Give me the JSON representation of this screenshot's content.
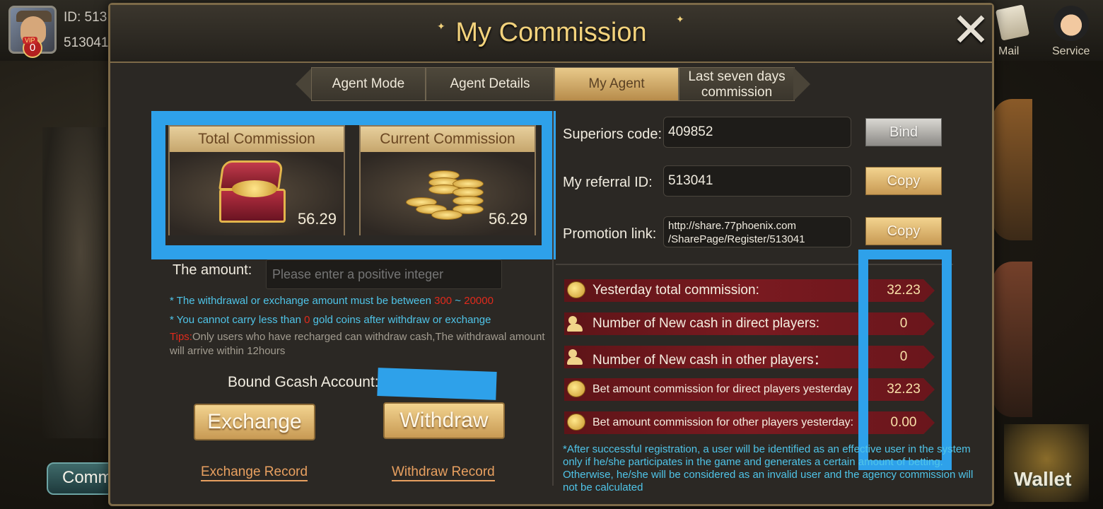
{
  "background": {
    "id_text": "ID: 513",
    "id_number": "513041",
    "vip_level": "0",
    "vip_tag": "VIP",
    "mail_label": "Mail",
    "service_label": "Service",
    "comm_label": "Comm",
    "wallet_label": "Wallet"
  },
  "modal": {
    "title": "My Commission",
    "close_icon": "close-icon"
  },
  "tabs": [
    {
      "label": "Agent Mode",
      "active": false
    },
    {
      "label": "Agent Details",
      "active": false
    },
    {
      "label": "My Agent",
      "active": true
    },
    {
      "label": "Last seven days commission",
      "active": false
    }
  ],
  "cards": {
    "total_label": "Total Commission",
    "total_value": "56.29",
    "current_label": "Current Commission",
    "current_value": "56.29"
  },
  "withdraw": {
    "amount_label": "The amount:",
    "amount_placeholder": "Please enter a positive integer",
    "note1_prefix": "* The withdrawal or exchange amount must be between ",
    "note1_min": "300",
    "note1_sep": " ~ ",
    "note1_max": "20000",
    "note2_prefix": "* You cannot carry less than ",
    "note2_value": "0",
    "note2_suffix": " gold coins after withdraw or exchange",
    "tips_label": "Tips:",
    "tips_text": "Only users who have recharged can withdraw cash,The withdrawal amount will arrive within 12hours",
    "gcash_label": "Bound Gcash Account:",
    "exchange_button": "Exchange",
    "withdraw_button": "Withdraw",
    "exchange_record": "Exchange Record",
    "withdraw_record": "Withdraw Record"
  },
  "agent_form": {
    "superiors_label": "Superiors code:",
    "superiors_value": "409852",
    "bind_button": "Bind",
    "referral_label": "My referral ID:",
    "referral_value": "513041",
    "copy_button": "Copy",
    "promotion_label": "Promotion link:",
    "promotion_value_line1": "http://share.77phoenix.com",
    "promotion_value_line2": "/SharePage/Register/513041",
    "copy_button2": "Copy"
  },
  "stats": [
    {
      "icon": "coin-icon",
      "label": "Yesterday total commission:",
      "value": "32.23"
    },
    {
      "icon": "people-icon",
      "label": "Number of New cash in direct players:",
      "value": "0"
    },
    {
      "icon": "people-icon",
      "label": "Number of New cash in other players：",
      "value": "0"
    },
    {
      "icon": "coin-icon",
      "label": "Bet amount commission for direct players yesterday",
      "value": "32.23"
    },
    {
      "icon": "coin-icon",
      "label": "Bet amount commission for other players yesterday:",
      "value": "0.00"
    }
  ],
  "footnote": "*After successful registration, a user will be identified as an effective user in the system only if he/she participates in the game and generates a certain amount of betting. Otherwise, he/she will be considered as an invalid user and the agency commission will not be calculated",
  "colors": {
    "accent_gold": "#f2d27c",
    "highlight_blue": "#2ea1ea",
    "note_cyan": "#4fc4e8",
    "stat_row_red": "#7a1a20",
    "warning_red": "#e02a1c"
  }
}
